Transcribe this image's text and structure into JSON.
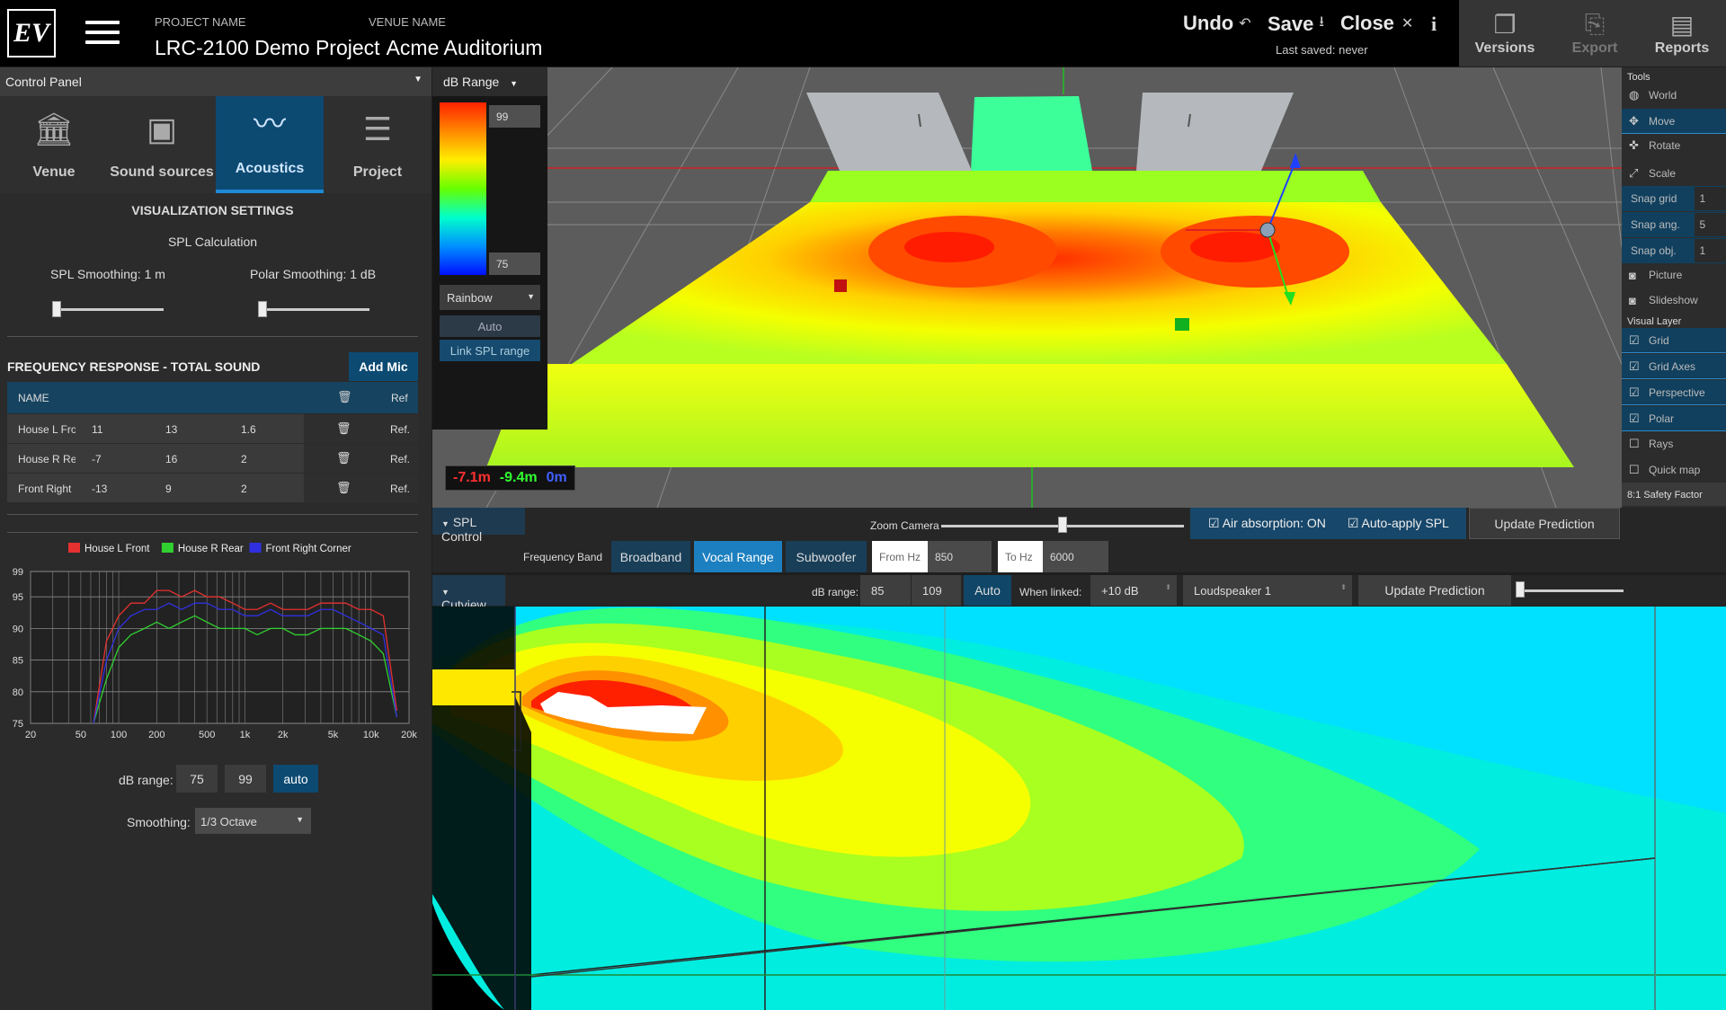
{
  "header": {
    "logo": "EV",
    "project_label": "PROJECT NAME",
    "venue_label": "VENUE NAME",
    "project_name": "LRC-2100 Demo Project",
    "venue_name": "Acme Auditorium",
    "undo": "Undo",
    "save": "Save",
    "close": "Close",
    "info": "i",
    "last_saved": "Last saved: never",
    "tools": [
      {
        "label": "Versions"
      },
      {
        "label": "Export"
      },
      {
        "label": "Reports"
      }
    ]
  },
  "control_panel": {
    "title": "Control Panel",
    "tabs": [
      {
        "label": "Venue"
      },
      {
        "label": "Sound sources"
      },
      {
        "label": "Acoustics"
      },
      {
        "label": "Project"
      }
    ],
    "vis_title": "VISUALIZATION SETTINGS",
    "spl_calc": "SPL Calculation",
    "spl_smoothing": "SPL Smoothing: 1 m",
    "polar_smoothing": "Polar Smoothing: 1 dB",
    "spl_smoothing_level": 0.0,
    "polar_smoothing_level": 0.0
  },
  "freq": {
    "title": "FREQUENCY RESPONSE - TOTAL SOUND",
    "add_mic": "Add Mic",
    "col_name": "NAME",
    "col_ref": "Ref",
    "rows": [
      {
        "name": "House L Fro",
        "a": "11",
        "b": "13",
        "c": "1.6",
        "ref": "Ref."
      },
      {
        "name": "House R Re",
        "a": "-7",
        "b": "16",
        "c": "2",
        "ref": "Ref."
      },
      {
        "name": "Front Right",
        "a": "-13",
        "b": "9",
        "c": "2",
        "ref": "Ref."
      }
    ],
    "db_range_label": "dB range:",
    "db_min": "75",
    "db_max": "99",
    "auto": "auto",
    "smoothing_label": "Smoothing:",
    "smoothing_value": "1/3 Octave"
  },
  "chart_data": {
    "type": "line",
    "title": "",
    "xlabel": "",
    "ylabel": "",
    "xscale": "log",
    "xlim": [
      20,
      20000
    ],
    "ylim": [
      75,
      99
    ],
    "x_ticks": [
      "20",
      "50",
      "100",
      "200",
      "500",
      "1k",
      "2k",
      "5k",
      "10k",
      "20k"
    ],
    "y_ticks": [
      "99",
      "95",
      "90",
      "85",
      "80",
      "75"
    ],
    "legend": "top",
    "x": [
      63,
      80,
      100,
      125,
      160,
      200,
      250,
      315,
      400,
      500,
      630,
      800,
      1000,
      1250,
      1600,
      2000,
      2500,
      3150,
      4000,
      5000,
      6300,
      8000,
      10000,
      12500,
      16000
    ],
    "series": [
      {
        "name": "House L Front",
        "color": "#e53030",
        "values": [
          75,
          88,
          92,
          94,
          94,
          96,
          96,
          95,
          96,
          95,
          95,
          94,
          93,
          93,
          94,
          93,
          93,
          93,
          94,
          94,
          94,
          93,
          93,
          92,
          77
        ]
      },
      {
        "name": "House R Rear",
        "color": "#30d030",
        "values": [
          75,
          82,
          87,
          89,
          90,
          91,
          90,
          91,
          92,
          91,
          90,
          90,
          90,
          89,
          90,
          90,
          89,
          89,
          90,
          90,
          90,
          89,
          88,
          86,
          76
        ]
      },
      {
        "name": "Front Right Corner",
        "color": "#3030e0",
        "values": [
          75,
          85,
          90,
          92,
          93,
          93,
          94,
          93,
          94,
          94,
          93,
          93,
          92,
          92,
          93,
          92,
          92,
          92,
          93,
          93,
          92,
          91,
          90,
          89,
          76
        ]
      }
    ]
  },
  "colorbar": {
    "title": "dB Range",
    "max": "99",
    "min": "75",
    "scheme": "Rainbow",
    "auto": "Auto",
    "link": "Link SPL range"
  },
  "coords": {
    "x": "-7.1m",
    "y": "-9.4m",
    "z": "0m"
  },
  "tools": {
    "title": "Tools",
    "items": [
      {
        "label": "World"
      },
      {
        "label": "Move"
      },
      {
        "label": "Rotate"
      },
      {
        "label": "Scale"
      }
    ],
    "snaps": [
      {
        "label": "Snap grid",
        "value": "1"
      },
      {
        "label": "Snap ang.",
        "value": "5"
      },
      {
        "label": "Snap obj.",
        "value": "1"
      }
    ],
    "picture": "Picture",
    "slideshow": "Slideshow",
    "visual_layer": "Visual Layer",
    "layers": [
      {
        "label": "Grid",
        "on": true
      },
      {
        "label": "Grid Axes",
        "on": true
      },
      {
        "label": "Perspective",
        "on": true
      },
      {
        "label": "Polar",
        "on": true
      },
      {
        "label": "Rays",
        "on": false
      },
      {
        "label": "Quick map",
        "on": false
      }
    ],
    "safety": "8:1 Safety Factor"
  },
  "spl": {
    "title": "SPL Control",
    "zoom": "Zoom Camera",
    "zoom_level": 0.5,
    "air": "Air absorption: ON",
    "autoapply": "Auto-apply SPL",
    "update": "Update Prediction",
    "band_label": "Frequency Band",
    "bands": [
      "Broadband",
      "Vocal Range",
      "Subwoofer"
    ],
    "from_label": "From Hz",
    "from_value": "850",
    "to_label": "To Hz",
    "to_value": "6000"
  },
  "cut": {
    "title": "Cutview",
    "db_label": "dB range:",
    "db_min": "85",
    "db_max": "109",
    "auto": "Auto",
    "when_linked": "When linked:",
    "linked_value": "+10 dB",
    "loudspeaker": "Loudspeaker 1",
    "update": "Update Prediction",
    "slider_level": 0.0
  }
}
